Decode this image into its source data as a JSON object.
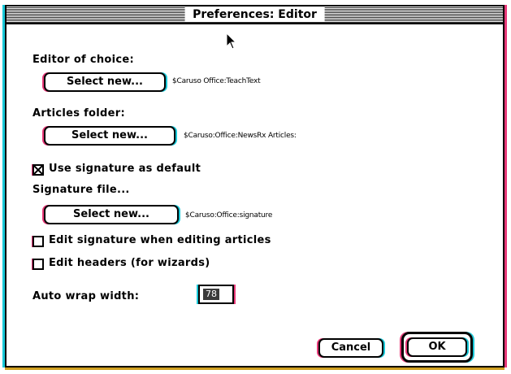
{
  "window": {
    "title": "Preferences: Editor"
  },
  "editor": {
    "label": "Editor of choice:",
    "button_label": "Select new...",
    "path": "$Caruso Office:TeachText"
  },
  "articles": {
    "label": "Articles folder:",
    "button_label": "Select new...",
    "path": "$Caruso:Office:NewsRx Articles:"
  },
  "use_signature": {
    "label": "Use signature as default",
    "checked": true
  },
  "signature": {
    "label": "Signature file...",
    "button_label": "Select new...",
    "path": "$Caruso:Office:signature"
  },
  "edit_signature": {
    "label": "Edit signature when editing articles",
    "checked": false
  },
  "edit_headers": {
    "label": "Edit headers (for wizards)",
    "checked": false
  },
  "auto_wrap": {
    "label": "Auto wrap width:",
    "value": "78"
  },
  "buttons": {
    "cancel": "Cancel",
    "ok": "OK"
  },
  "colors": {
    "fringe_cyan": "#18c8d8",
    "fringe_magenta": "#e83878",
    "fringe_yellow": "#d0a020"
  },
  "icons": {
    "cursor": "arrow-cursor-icon"
  }
}
